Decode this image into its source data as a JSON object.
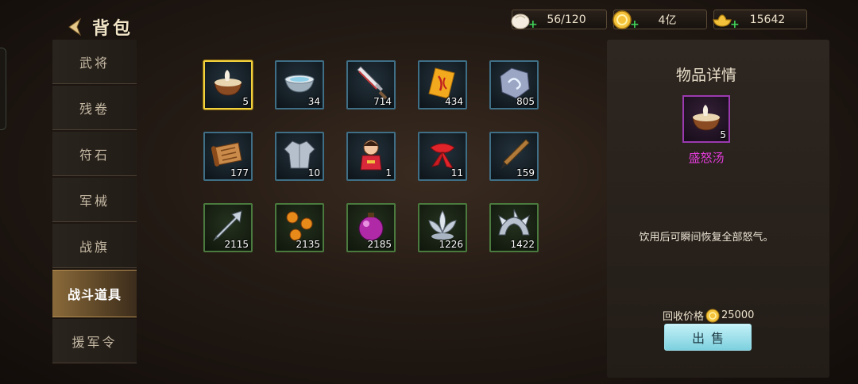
{
  "header": {
    "title": "背包",
    "back_icon": "chevron-left-icon"
  },
  "resources": [
    {
      "name": "bun",
      "icon": "steamed-bun-icon",
      "value": "56/120"
    },
    {
      "name": "gold",
      "icon": "gold-coin-icon",
      "value": "4亿"
    },
    {
      "name": "ingot",
      "icon": "gold-ingot-icon",
      "value": "15642"
    }
  ],
  "sidebar": {
    "tabs": [
      "武将",
      "残卷",
      "符石",
      "军械",
      "战旗",
      "战斗道具",
      "援军令"
    ],
    "active_index": 5
  },
  "items": [
    {
      "icon": "soup-bowl-icon",
      "count": "5",
      "selected": true
    },
    {
      "icon": "silver-bowl-icon",
      "count": "34"
    },
    {
      "icon": "sword-icon",
      "count": "714"
    },
    {
      "icon": "talisman-icon",
      "count": "434"
    },
    {
      "icon": "rune-stone-icon",
      "count": "805"
    },
    {
      "icon": "scroll-icon",
      "count": "177"
    },
    {
      "icon": "armor-shirt-icon",
      "count": "10"
    },
    {
      "icon": "doll-icon",
      "count": "1"
    },
    {
      "icon": "red-scarf-icon",
      "count": "11"
    },
    {
      "icon": "brush-icon",
      "count": "159"
    },
    {
      "icon": "arrowhead-icon",
      "count": "2115"
    },
    {
      "icon": "orange-orbs-icon",
      "count": "2135"
    },
    {
      "icon": "bomb-icon",
      "count": "2185"
    },
    {
      "icon": "silver-lotus-icon",
      "count": "1226"
    },
    {
      "icon": "spiked-ring-icon",
      "count": "1422"
    }
  ],
  "detail": {
    "title": "物品详情",
    "item_count": "5",
    "item_name": "盛怒汤",
    "description": "饮用后可瞬间恢复全部怒气。",
    "price_label": "回收价格",
    "price_value": "25000",
    "sell_label": "出售"
  },
  "colors": {
    "selected_border": "#f2d23c",
    "item_name": "#e03bd8",
    "plus": "#3fd058",
    "sell_button": "#7dd1df"
  }
}
